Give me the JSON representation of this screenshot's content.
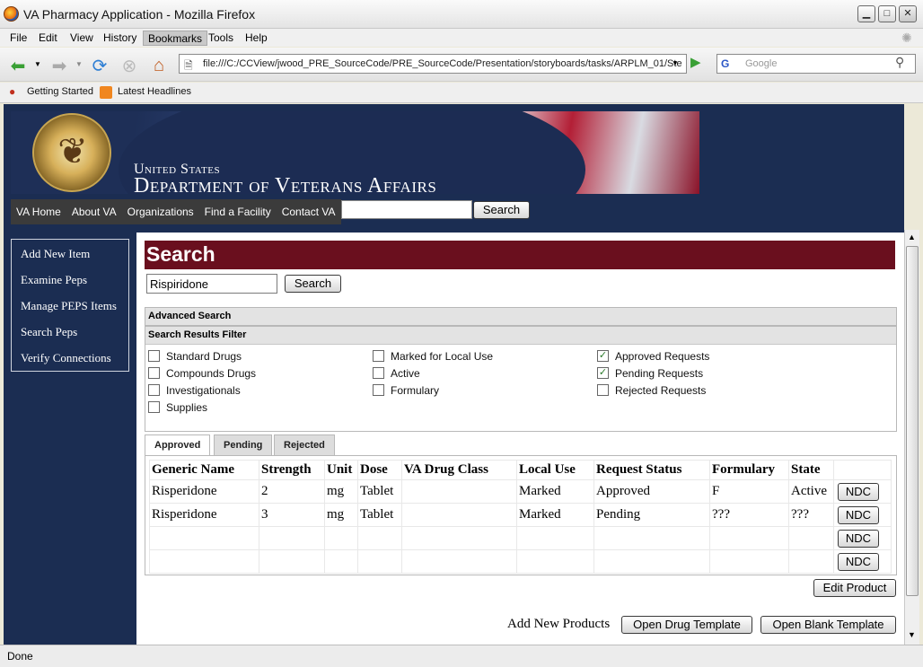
{
  "window": {
    "title": "VA Pharmacy Application - Mozilla Firefox"
  },
  "menubar": [
    "File",
    "Edit",
    "View",
    "History",
    "Bookmarks",
    "Tools",
    "Help"
  ],
  "address": {
    "url": "file:///C:/CCView/jwood_PRE_SourceCode/PRE_SourceCode/Presentation/storyboards/tasks/ARPLM_01/Ste",
    "search_placeholder": "Google",
    "search_engine": "G"
  },
  "bookmarks": [
    "Getting Started",
    "Latest Headlines"
  ],
  "banner": {
    "line1": "United States",
    "line2": "Department of Veterans Affairs"
  },
  "topnav": {
    "items": [
      "VA Home",
      "About VA",
      "Organizations",
      "Find a Facility",
      "Contact VA"
    ],
    "search_button": "Search"
  },
  "sidebar": [
    "Add New Item",
    "Examine Peps",
    "Manage PEPS Items",
    "Search Peps",
    "Verify Connections"
  ],
  "main": {
    "heading": "Search",
    "search_value": "Rispiridone",
    "search_button": "Search",
    "advanced_search": "Advanced Search",
    "filter_title": "Search Results Filter",
    "filters": [
      {
        "label": "Standard Drugs",
        "checked": false
      },
      {
        "label": "Compounds Drugs",
        "checked": false
      },
      {
        "label": "Investigationals",
        "checked": false
      },
      {
        "label": "Supplies",
        "checked": false
      },
      {
        "label": "Marked for Local Use",
        "checked": false
      },
      {
        "label": "Active",
        "checked": false
      },
      {
        "label": "Formulary",
        "checked": false
      },
      {
        "label": "Approved Requests",
        "checked": true
      },
      {
        "label": "Pending Requests",
        "checked": true
      },
      {
        "label": "Rejected Requests",
        "checked": false
      }
    ],
    "tabs": [
      "Approved",
      "Pending",
      "Rejected"
    ],
    "columns": [
      "Generic Name",
      "Strength",
      "Unit",
      "Dose",
      "VA Drug Class",
      "Local Use",
      "Request Status",
      "Formulary",
      "State"
    ],
    "rows": [
      [
        "Risperidone",
        "2",
        "mg",
        "Tablet",
        "",
        "Marked",
        "Approved",
        "F",
        "Active"
      ],
      [
        "Risperidone",
        "3",
        "mg",
        "Tablet",
        "",
        "Marked",
        "Pending",
        "???",
        "???"
      ],
      [
        "",
        "",
        "",
        "",
        "",
        "",
        "",
        "",
        ""
      ],
      [
        "",
        "",
        "",
        "",
        "",
        "",
        "",
        "",
        ""
      ]
    ],
    "ndc_label": "NDC",
    "edit_product": "Edit Product",
    "add_new_products": "Add New Products",
    "open_drug_template": "Open Drug Template",
    "open_blank_template": "Open Blank Template"
  },
  "status": "Done",
  "colors": {
    "page_bg": "#1b2d52",
    "heading_bg": "#6a0f1e",
    "check": "#2a7a2a"
  }
}
